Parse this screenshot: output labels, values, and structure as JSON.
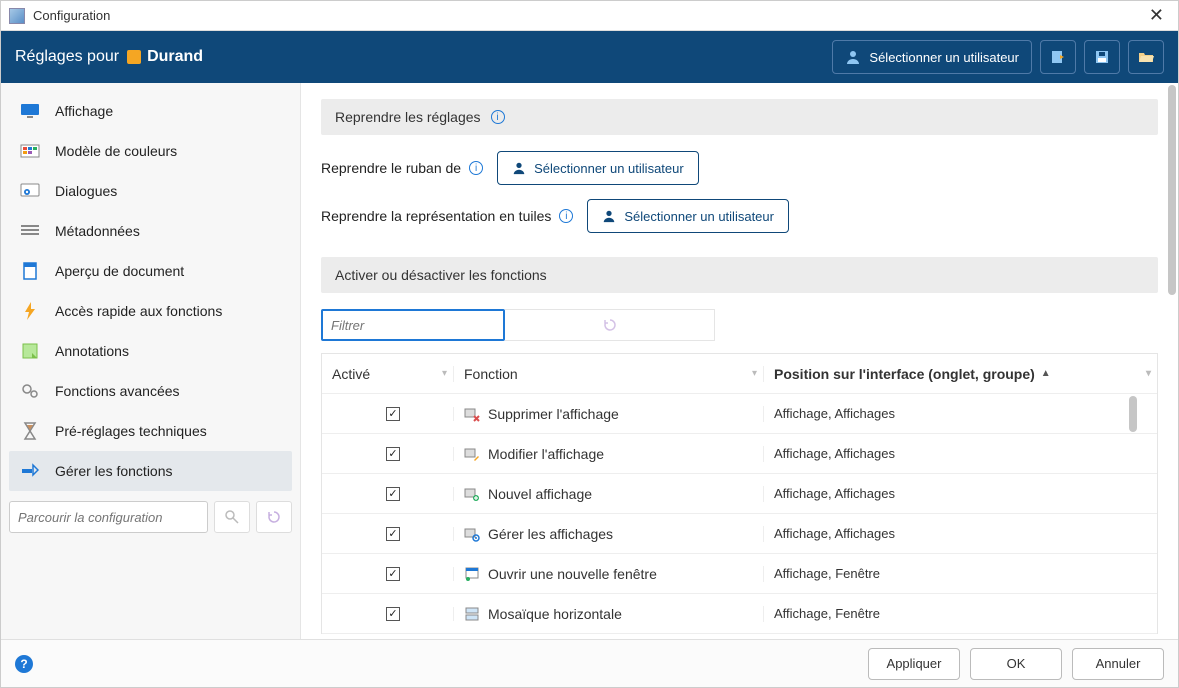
{
  "window": {
    "title": "Configuration"
  },
  "header": {
    "prefix": "Réglages pour",
    "username": "Durand",
    "select_user": "Sélectionner un utilisateur"
  },
  "sidebar": {
    "items": [
      {
        "label": "Affichage"
      },
      {
        "label": "Modèle de couleurs"
      },
      {
        "label": "Dialogues"
      },
      {
        "label": "Métadonnées"
      },
      {
        "label": "Aperçu de document"
      },
      {
        "label": "Accès rapide aux fonctions"
      },
      {
        "label": "Annotations"
      },
      {
        "label": "Fonctions avancées"
      },
      {
        "label": "Pré-réglages techniques"
      },
      {
        "label": "Gérer les fonctions"
      }
    ],
    "search_placeholder": "Parcourir la configuration"
  },
  "main": {
    "section1_title": "Reprendre les réglages",
    "ribbon_label": "Reprendre le ruban de",
    "tiles_label": "Reprendre la représentation en tuiles",
    "select_user": "Sélectionner un utilisateur",
    "section2_title": "Activer ou désactiver les fonctions",
    "filter_placeholder": "Filtrer",
    "columns": {
      "enabled": "Activé",
      "function": "Fonction",
      "position": "Position sur l'interface (onglet, groupe)"
    },
    "rows": [
      {
        "fn": "Supprimer l'affichage",
        "pos": "Affichage, Affichages"
      },
      {
        "fn": "Modifier l'affichage",
        "pos": "Affichage, Affichages"
      },
      {
        "fn": "Nouvel affichage",
        "pos": "Affichage, Affichages"
      },
      {
        "fn": "Gérer les affichages",
        "pos": "Affichage, Affichages"
      },
      {
        "fn": "Ouvrir une nouvelle fenêtre",
        "pos": "Affichage, Fenêtre"
      },
      {
        "fn": "Mosaïque horizontale",
        "pos": "Affichage, Fenêtre"
      }
    ]
  },
  "footer": {
    "apply": "Appliquer",
    "ok": "OK",
    "cancel": "Annuler"
  }
}
